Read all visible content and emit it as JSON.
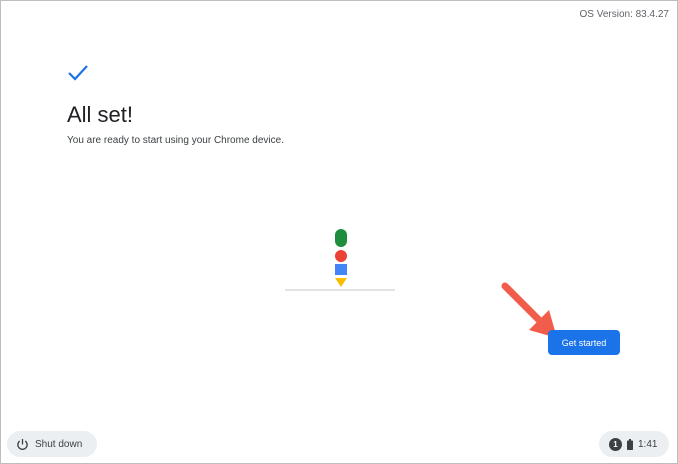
{
  "os_version": "OS Version: 83.4.27",
  "page": {
    "title": "All set!",
    "subtitle": "You are ready to start using your Chrome device."
  },
  "get_started_label": "Get started",
  "shelf": {
    "shutdown_label": "Shut down",
    "notification_count": "1",
    "time": "1:41"
  },
  "colors": {
    "accent_blue": "#1a73e8",
    "google_green": "#1e8e3e",
    "google_red": "#ea4335",
    "google_blue": "#4285f4",
    "google_yellow": "#fbbc04",
    "annotation_arrow": "#f25c4b"
  },
  "icons": [
    "checkmark-icon",
    "power-icon",
    "battery-icon",
    "notification-badge",
    "annotation-arrow"
  ]
}
